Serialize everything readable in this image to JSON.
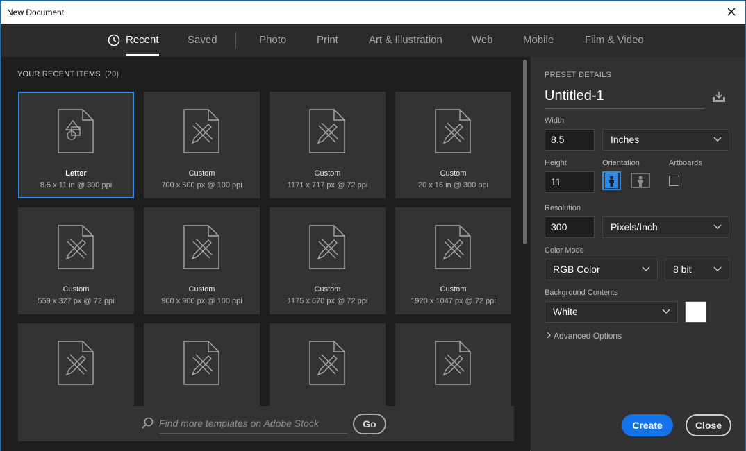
{
  "window": {
    "title": "New Document"
  },
  "tabs": [
    {
      "label": "Recent"
    },
    {
      "label": "Saved"
    },
    {
      "label": "Photo"
    },
    {
      "label": "Print"
    },
    {
      "label": "Art & Illustration"
    },
    {
      "label": "Web"
    },
    {
      "label": "Mobile"
    },
    {
      "label": "Film & Video"
    }
  ],
  "recent": {
    "title": "YOUR RECENT ITEMS",
    "count": "(20)",
    "items": [
      {
        "name": "Letter",
        "dims": "8.5 x 11 in @ 300 ppi"
      },
      {
        "name": "Custom",
        "dims": "700 x 500 px @ 100 ppi"
      },
      {
        "name": "Custom",
        "dims": "1171 x 717 px @ 72 ppi"
      },
      {
        "name": "Custom",
        "dims": "20 x 16 in @ 300 ppi"
      },
      {
        "name": "Custom",
        "dims": "559 x 327 px @ 72 ppi"
      },
      {
        "name": "Custom",
        "dims": "900 x 900 px @ 100 ppi"
      },
      {
        "name": "Custom",
        "dims": "1175 x 670 px @ 72 ppi"
      },
      {
        "name": "Custom",
        "dims": "1920 x 1047 px @ 72 ppi"
      }
    ]
  },
  "stock": {
    "placeholder": "Find more templates on Adobe Stock",
    "go_label": "Go"
  },
  "preset": {
    "title": "PRESET DETAILS",
    "doc_name": "Untitled-1",
    "width_label": "Width",
    "width_value": "8.5",
    "width_unit": "Inches",
    "height_label": "Height",
    "height_value": "11",
    "orientation_label": "Orientation",
    "artboards_label": "Artboards",
    "resolution_label": "Resolution",
    "resolution_value": "300",
    "resolution_unit": "Pixels/Inch",
    "color_mode_label": "Color Mode",
    "color_mode_value": "RGB Color",
    "bit_depth": "8 bit",
    "background_label": "Background Contents",
    "background_value": "White",
    "advanced_label": "Advanced Options"
  },
  "buttons": {
    "create": "Create",
    "close": "Close"
  },
  "colors": {
    "accent": "#1473e6",
    "selected_border": "#2d8ceb"
  }
}
